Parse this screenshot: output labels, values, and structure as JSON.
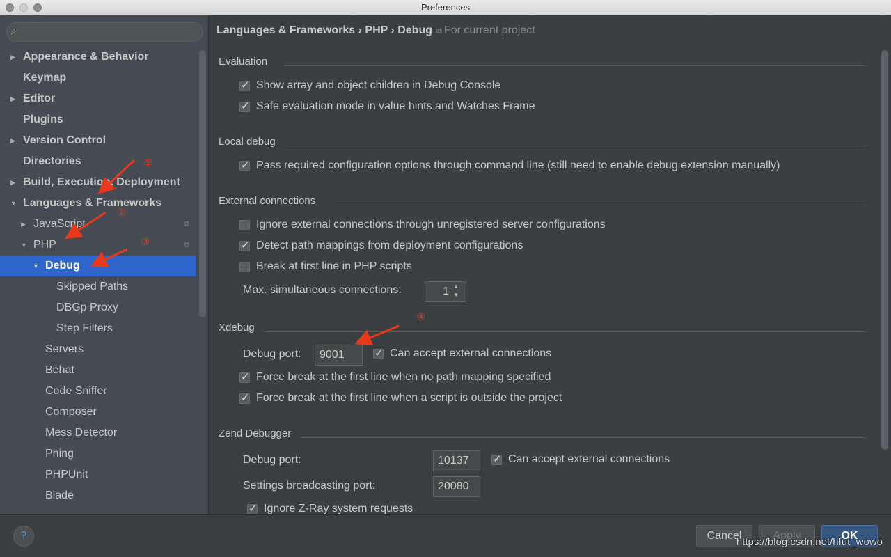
{
  "window": {
    "title": "Preferences"
  },
  "sidebar": {
    "search_placeholder": "",
    "items": [
      {
        "label": "Appearance & Behavior",
        "arrow": "▶",
        "bold": true,
        "indent": 0
      },
      {
        "label": "Keymap",
        "arrow": "",
        "bold": true,
        "indent": 0
      },
      {
        "label": "Editor",
        "arrow": "▶",
        "bold": true,
        "indent": 0
      },
      {
        "label": "Plugins",
        "arrow": "",
        "bold": true,
        "indent": 0
      },
      {
        "label": "Version Control",
        "arrow": "▶",
        "bold": true,
        "indent": 0
      },
      {
        "label": "Directories",
        "arrow": "",
        "bold": true,
        "indent": 0
      },
      {
        "label": "Build, Execution, Deployment",
        "arrow": "▶",
        "bold": true,
        "indent": 0
      },
      {
        "label": "Languages & Frameworks",
        "arrow": "▼",
        "bold": true,
        "indent": 0
      },
      {
        "label": "JavaScript",
        "arrow": "▶",
        "indent": 1,
        "proj": true
      },
      {
        "label": "PHP",
        "arrow": "▼",
        "indent": 1,
        "proj": true
      },
      {
        "label": "Debug",
        "arrow": "▼",
        "indent": 2,
        "selected": true
      },
      {
        "label": "Skipped Paths",
        "arrow": "",
        "indent": 3
      },
      {
        "label": "DBGp Proxy",
        "arrow": "",
        "indent": 3
      },
      {
        "label": "Step Filters",
        "arrow": "",
        "indent": 3
      },
      {
        "label": "Servers",
        "arrow": "",
        "indent": 2
      },
      {
        "label": "Behat",
        "arrow": "",
        "indent": 2
      },
      {
        "label": "Code Sniffer",
        "arrow": "",
        "indent": 2
      },
      {
        "label": "Composer",
        "arrow": "",
        "indent": 2
      },
      {
        "label": "Mess Detector",
        "arrow": "",
        "indent": 2
      },
      {
        "label": "Phing",
        "arrow": "",
        "indent": 2
      },
      {
        "label": "PHPUnit",
        "arrow": "",
        "indent": 2
      },
      {
        "label": "Blade",
        "arrow": "",
        "indent": 2
      }
    ]
  },
  "breadcrumb": {
    "path": "Languages & Frameworks › PHP › Debug",
    "scope": "For current project"
  },
  "sections": {
    "evaluation": {
      "title": "Evaluation",
      "opt1": "Show array and object children in Debug Console",
      "opt2": "Safe evaluation mode in value hints and Watches Frame"
    },
    "local": {
      "title": "Local debug",
      "opt1": "Pass required configuration options through command line (still need to enable debug extension manually)"
    },
    "external": {
      "title": "External connections",
      "opt1": "Ignore external connections through unregistered server configurations",
      "opt2": "Detect path mappings from deployment configurations",
      "opt3": "Break at first line in PHP scripts",
      "max_label": "Max. simultaneous connections:",
      "max_value": "1"
    },
    "xdebug": {
      "title": "Xdebug",
      "port_label": "Debug port:",
      "port_value": "9001",
      "accept": "Can accept external connections",
      "opt1": "Force break at the first line when no path mapping specified",
      "opt2": "Force break at the first line when a script is outside the project"
    },
    "zend": {
      "title": "Zend Debugger",
      "port_label": "Debug port:",
      "port_value": "10137",
      "accept": "Can accept external connections",
      "bcast_label": "Settings broadcasting port:",
      "bcast_value": "20080",
      "ignore": "Ignore Z-Ray system requests"
    }
  },
  "footer": {
    "help": "?",
    "cancel": "Cancel",
    "apply": "Apply",
    "ok": "OK"
  },
  "annotations": {
    "a1": "①",
    "a2": "②",
    "a3": "③",
    "a4": "④",
    "color": "#e8391d"
  },
  "watermark": "https://blog.csdn.net/hfut_wowo"
}
